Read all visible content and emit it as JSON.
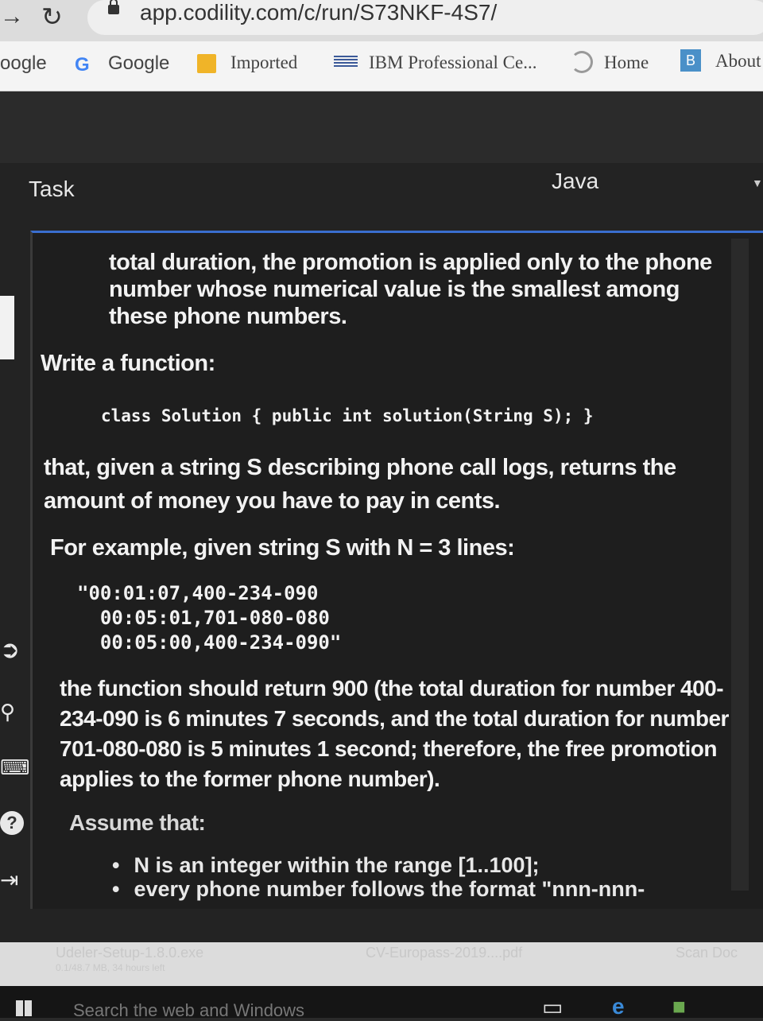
{
  "browser": {
    "url": "app.codility.com/c/run/S73NKF-4S7/",
    "bookmarks": [
      {
        "label": "oogle"
      },
      {
        "label": "Google"
      },
      {
        "label": "Imported"
      },
      {
        "label": "IBM Professional Ce..."
      },
      {
        "label": "Home"
      },
      {
        "label": "About"
      }
    ]
  },
  "header": {
    "task_label": "Task",
    "language": "Java"
  },
  "task": {
    "intro": "total duration, the promotion is applied only to the phone number whose numerical value is the smallest among these phone numbers.",
    "write_fn": "Write a function:",
    "signature": "class Solution { public int solution(String S); }",
    "description": "that, given a string S describing phone call logs, returns the amount of money you have to pay in cents.",
    "example_intro": "For example, given string S with N = 3 lines:",
    "example_code": "\"00:01:07,400-234-090\n  00:05:01,701-080-080\n  00:05:00,400-234-090\"",
    "explanation": "the function should return 900 (the total duration for number 400-234-090 is 6 minutes 7 seconds, and the total duration for number 701-080-080 is 5 minutes 1 second; therefore, the free promotion applies to the former phone number).",
    "assume": "Assume that:",
    "assumptions": [
      "N is an integer within the range [1..100];",
      "every phone number follows the format \"nnn-nnn-"
    ]
  },
  "downloads": {
    "item1": "Udeler-Setup-1.8.0.exe",
    "item1_sub": "0.1/48.7 MB, 34 hours left",
    "item2": "CV-Europass-2019....pdf",
    "item3": "Scan Doc"
  },
  "taskbar": {
    "search_placeholder": "Search the web and Windows"
  }
}
